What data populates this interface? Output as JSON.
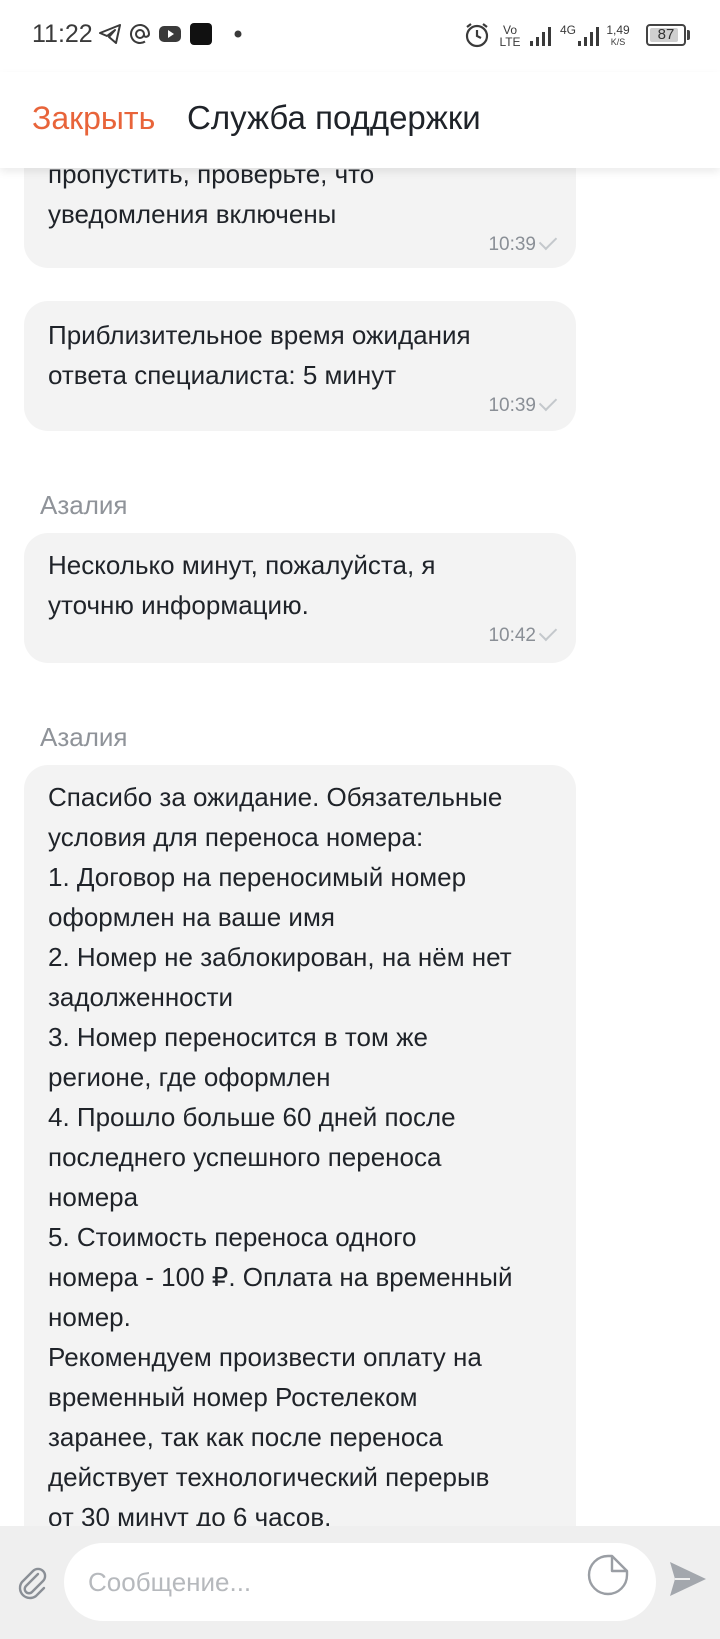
{
  "status_bar": {
    "time": "11:22",
    "volte_top": "Vo",
    "volte_bottom": "LTE",
    "network_4g": "4G",
    "speed_value": "1,49",
    "speed_unit": "K/S",
    "battery": "87",
    "battery_level": 0.87
  },
  "header": {
    "close_label": "Закрыть",
    "title": "Служба поддержки",
    "accent_color": "#e8643a"
  },
  "messages": [
    {
      "sender": "",
      "text": "пропустить, проверьте, что\nуведомления включены",
      "time": "10:39"
    },
    {
      "sender": "",
      "text": "Приблизительное время ожидания\nответа специалиста: 5 минут",
      "time": "10:39"
    },
    {
      "sender": "Азалия",
      "text": "Несколько минут, пожалуйста, я\nуточню информацию.",
      "time": "10:42"
    },
    {
      "sender": "Азалия",
      "text": "Спасибо за ожидание. Обязательные\nусловия для переноса номера:\n1. Договор на переносимый номер\nоформлен на ваше имя\n2. Номер не заблокирован, на нём нет\nзадолженности\n3. Номер переносится в том же\nрегионе, где оформлен\n4. Прошло больше 60 дней после\nпоследнего успешного переноса\nномера\n5. Стоимость переноса одного\nномера - 100 ₽. Оплата на временный\nномер.\nРекомендуем произвести оплату на\nвременный номер Ростелеком\nзаранее, так как после переноса\nдействует технологический перерыв\nот 30 минут до 6 часов.",
      "time": ""
    }
  ],
  "composer": {
    "placeholder": "Сообщение..."
  }
}
